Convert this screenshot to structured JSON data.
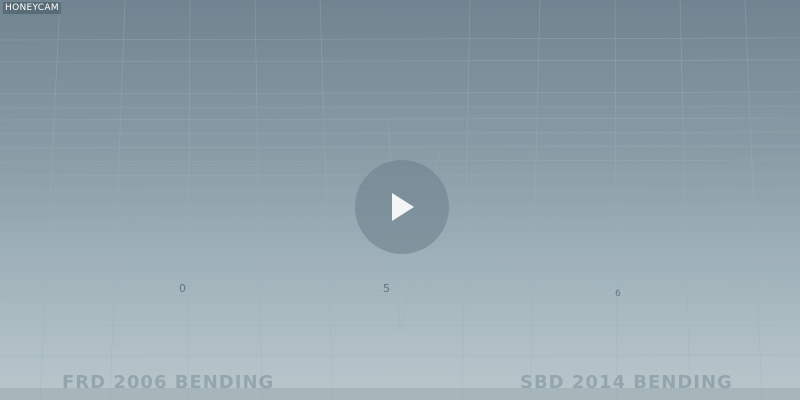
{
  "watermark": "HONEYCAM",
  "axis_labels": {
    "zero": "0",
    "five": "5",
    "six": "6"
  },
  "captions": {
    "left": "FRD 2006 BENDING",
    "right": "SBD 2014 BENDING"
  },
  "player": {
    "play_icon": "play-icon"
  },
  "colors": {
    "background_top": "#6f8490",
    "background_bottom": "#b9c7cc",
    "grid_line": "#9fb2ba",
    "play_circle": "#6e828e"
  }
}
